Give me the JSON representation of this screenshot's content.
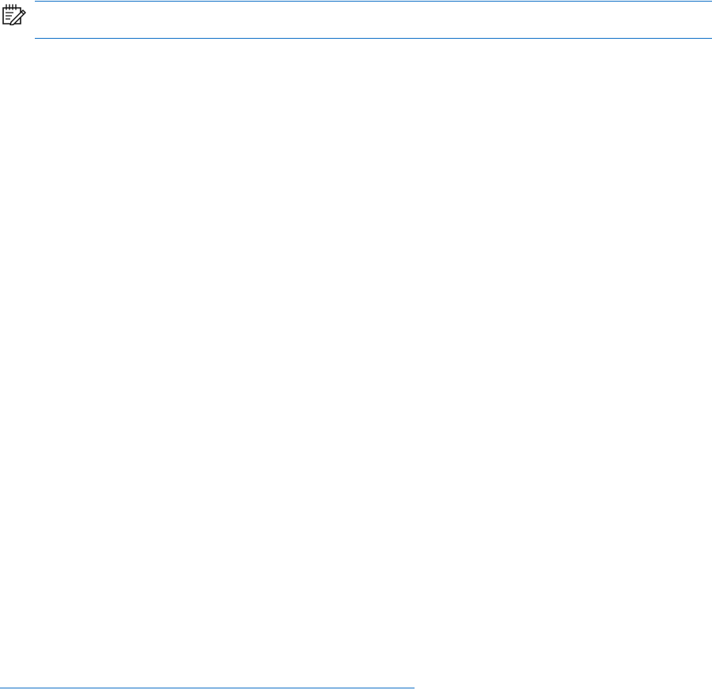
{
  "note": {
    "icon": "note-icon",
    "rule_color": "#0f6fc6",
    "text": ""
  },
  "footer": {
    "rule_color": "#0f6fc6"
  }
}
